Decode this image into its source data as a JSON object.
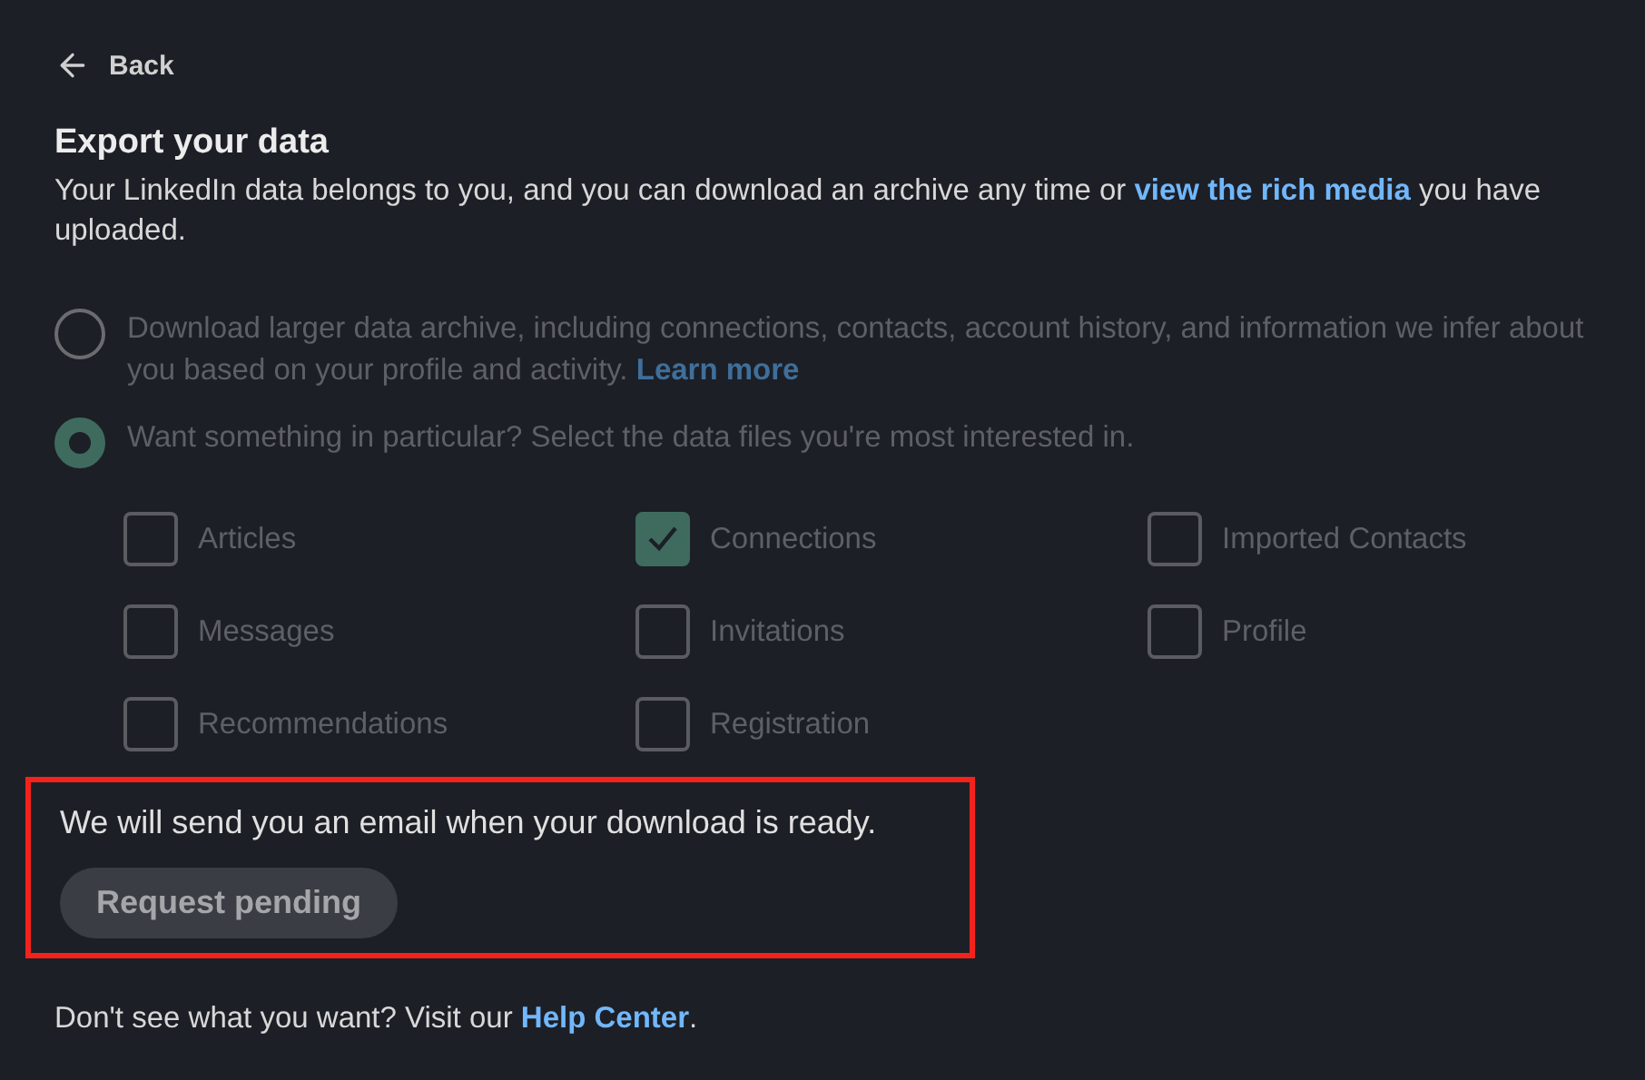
{
  "back": {
    "label": "Back"
  },
  "title": "Export your data",
  "intro": {
    "text": "Your LinkedIn data belongs to you, and you can download an archive any time or",
    "link": "view the rich media",
    "tail": "you have uploaded."
  },
  "options": [
    {
      "text": "Download larger data archive, including connections, contacts, account history, and information we infer about you based on your profile and activity.",
      "link": "Learn more",
      "selected": false,
      "disabled": true
    },
    {
      "text": "Want something in particular? Select the data files you're most interested in.",
      "selected": true,
      "disabled": true
    }
  ],
  "files": [
    {
      "label": "Articles",
      "checked": false
    },
    {
      "label": "Connections",
      "checked": true
    },
    {
      "label": "Imported Contacts",
      "checked": false
    },
    {
      "label": "Messages",
      "checked": false
    },
    {
      "label": "Invitations",
      "checked": false
    },
    {
      "label": "Profile",
      "checked": false
    },
    {
      "label": "Recommendations",
      "checked": false
    },
    {
      "label": "Registration",
      "checked": false
    }
  ],
  "notice": {
    "highlighted": true,
    "message": "We will send you an email when your download is ready.",
    "button": {
      "label": "Request pending",
      "disabled": true
    }
  },
  "help": {
    "text": "Don't see what you want? Visit our",
    "link": "Help Center",
    "tail": "."
  }
}
